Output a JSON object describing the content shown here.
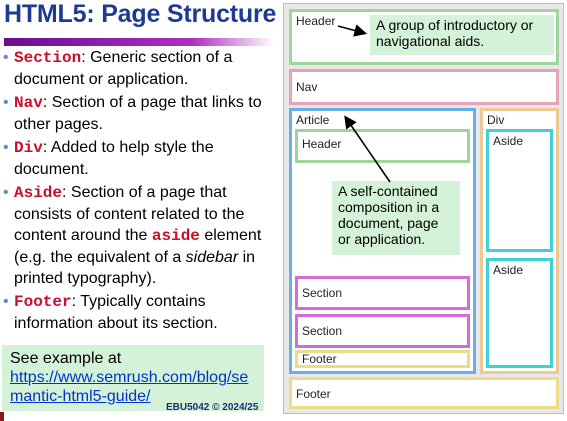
{
  "title": "HTML5: Page Structure",
  "bullets": [
    {
      "kw": "Section",
      "text": ": Generic section of a document or application."
    },
    {
      "kw": "Nav",
      "text": ": Section of a page that links to other pages."
    },
    {
      "kw": "Div",
      "text": ": Added to help style the document."
    },
    {
      "kw": "Aside",
      "text_before": ": Section of a page that consists of content related to the content around the ",
      "kw2": "aside",
      "text_mid": " element (e.g. the equivalent of a ",
      "em": "sidebar",
      "text_after": " in printed typography)."
    },
    {
      "kw": "Footer",
      "text": ": Typically contains information about its section."
    }
  ],
  "see_example": {
    "label": "See example at",
    "link": "https://www.semrush.com/blog/semantic-html5-guide/"
  },
  "footer_note": "EBU5042 © 2024/25",
  "diagram": {
    "header": "Header",
    "header_note": "A group of introductory or navigational aids.",
    "nav": "Nav",
    "article": "Article",
    "article_header": "Header",
    "article_note": "A self-contained composition in a document, page or application.",
    "section1": "Section",
    "section2": "Section",
    "article_footer": "Footer",
    "div": "Div",
    "aside1": "Aside",
    "aside2": "Aside",
    "page_footer": "Footer"
  },
  "colors": {
    "header_border": "#9fd49a",
    "nav_border": "#e6a3b8",
    "article_border": "#6aaee8",
    "div_border": "#f0c896",
    "aside_border": "#3cd2d8",
    "section_border": "#d36bd8",
    "footer_border": "#ecdc8a"
  }
}
